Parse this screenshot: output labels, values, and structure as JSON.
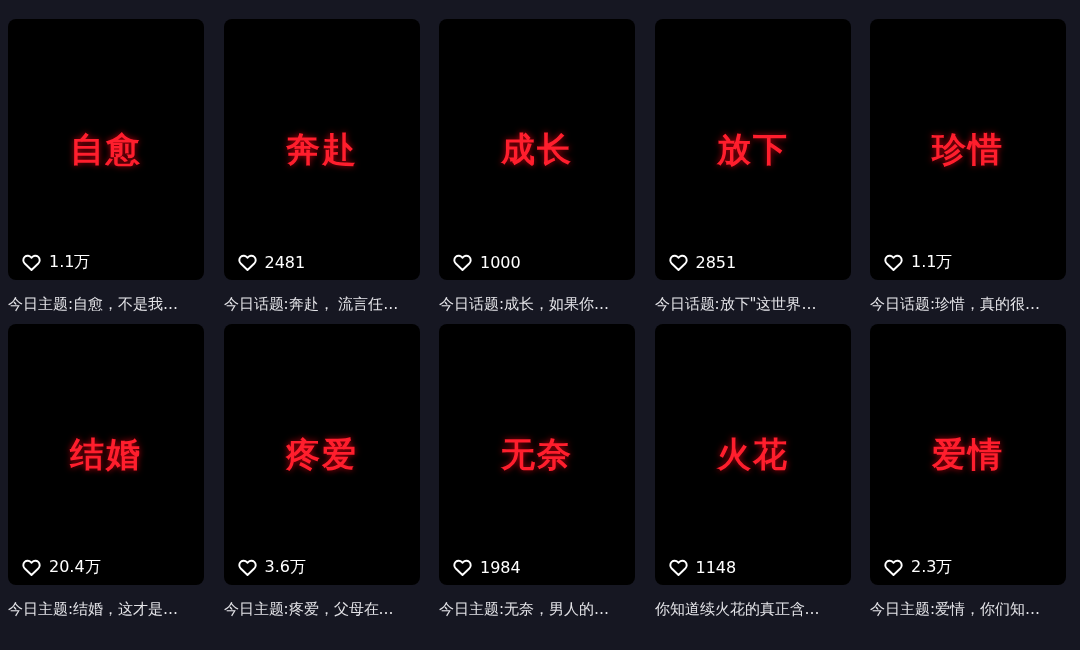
{
  "videos": [
    {
      "cover_title": "自愈",
      "likes": "1.1万",
      "caption": "今日主题:自愈，不是我…"
    },
    {
      "cover_title": "奔赴",
      "likes": "2481",
      "caption": "今日话题:奔赴， 流言任…"
    },
    {
      "cover_title": "成长",
      "likes": "1000",
      "caption": "今日话题:成长，如果你…"
    },
    {
      "cover_title": "放下",
      "likes": "2851",
      "caption": "今日话题:放下\"这世界…"
    },
    {
      "cover_title": "珍惜",
      "likes": "1.1万",
      "caption": "今日话题:珍惜，真的很…"
    },
    {
      "cover_title": "结婚",
      "likes": "20.4万",
      "caption": "今日主题:结婚，这才是…"
    },
    {
      "cover_title": "疼爱",
      "likes": "3.6万",
      "caption": "今日主题:疼爱，父母在…"
    },
    {
      "cover_title": "无奈",
      "likes": "1984",
      "caption": "今日主题:无奈，男人的…"
    },
    {
      "cover_title": "火花",
      "likes": "1148",
      "caption": "你知道续火花的真正含…"
    },
    {
      "cover_title": "爱情",
      "likes": "2.3万",
      "caption": "今日主题:爱情，你们知…"
    }
  ]
}
